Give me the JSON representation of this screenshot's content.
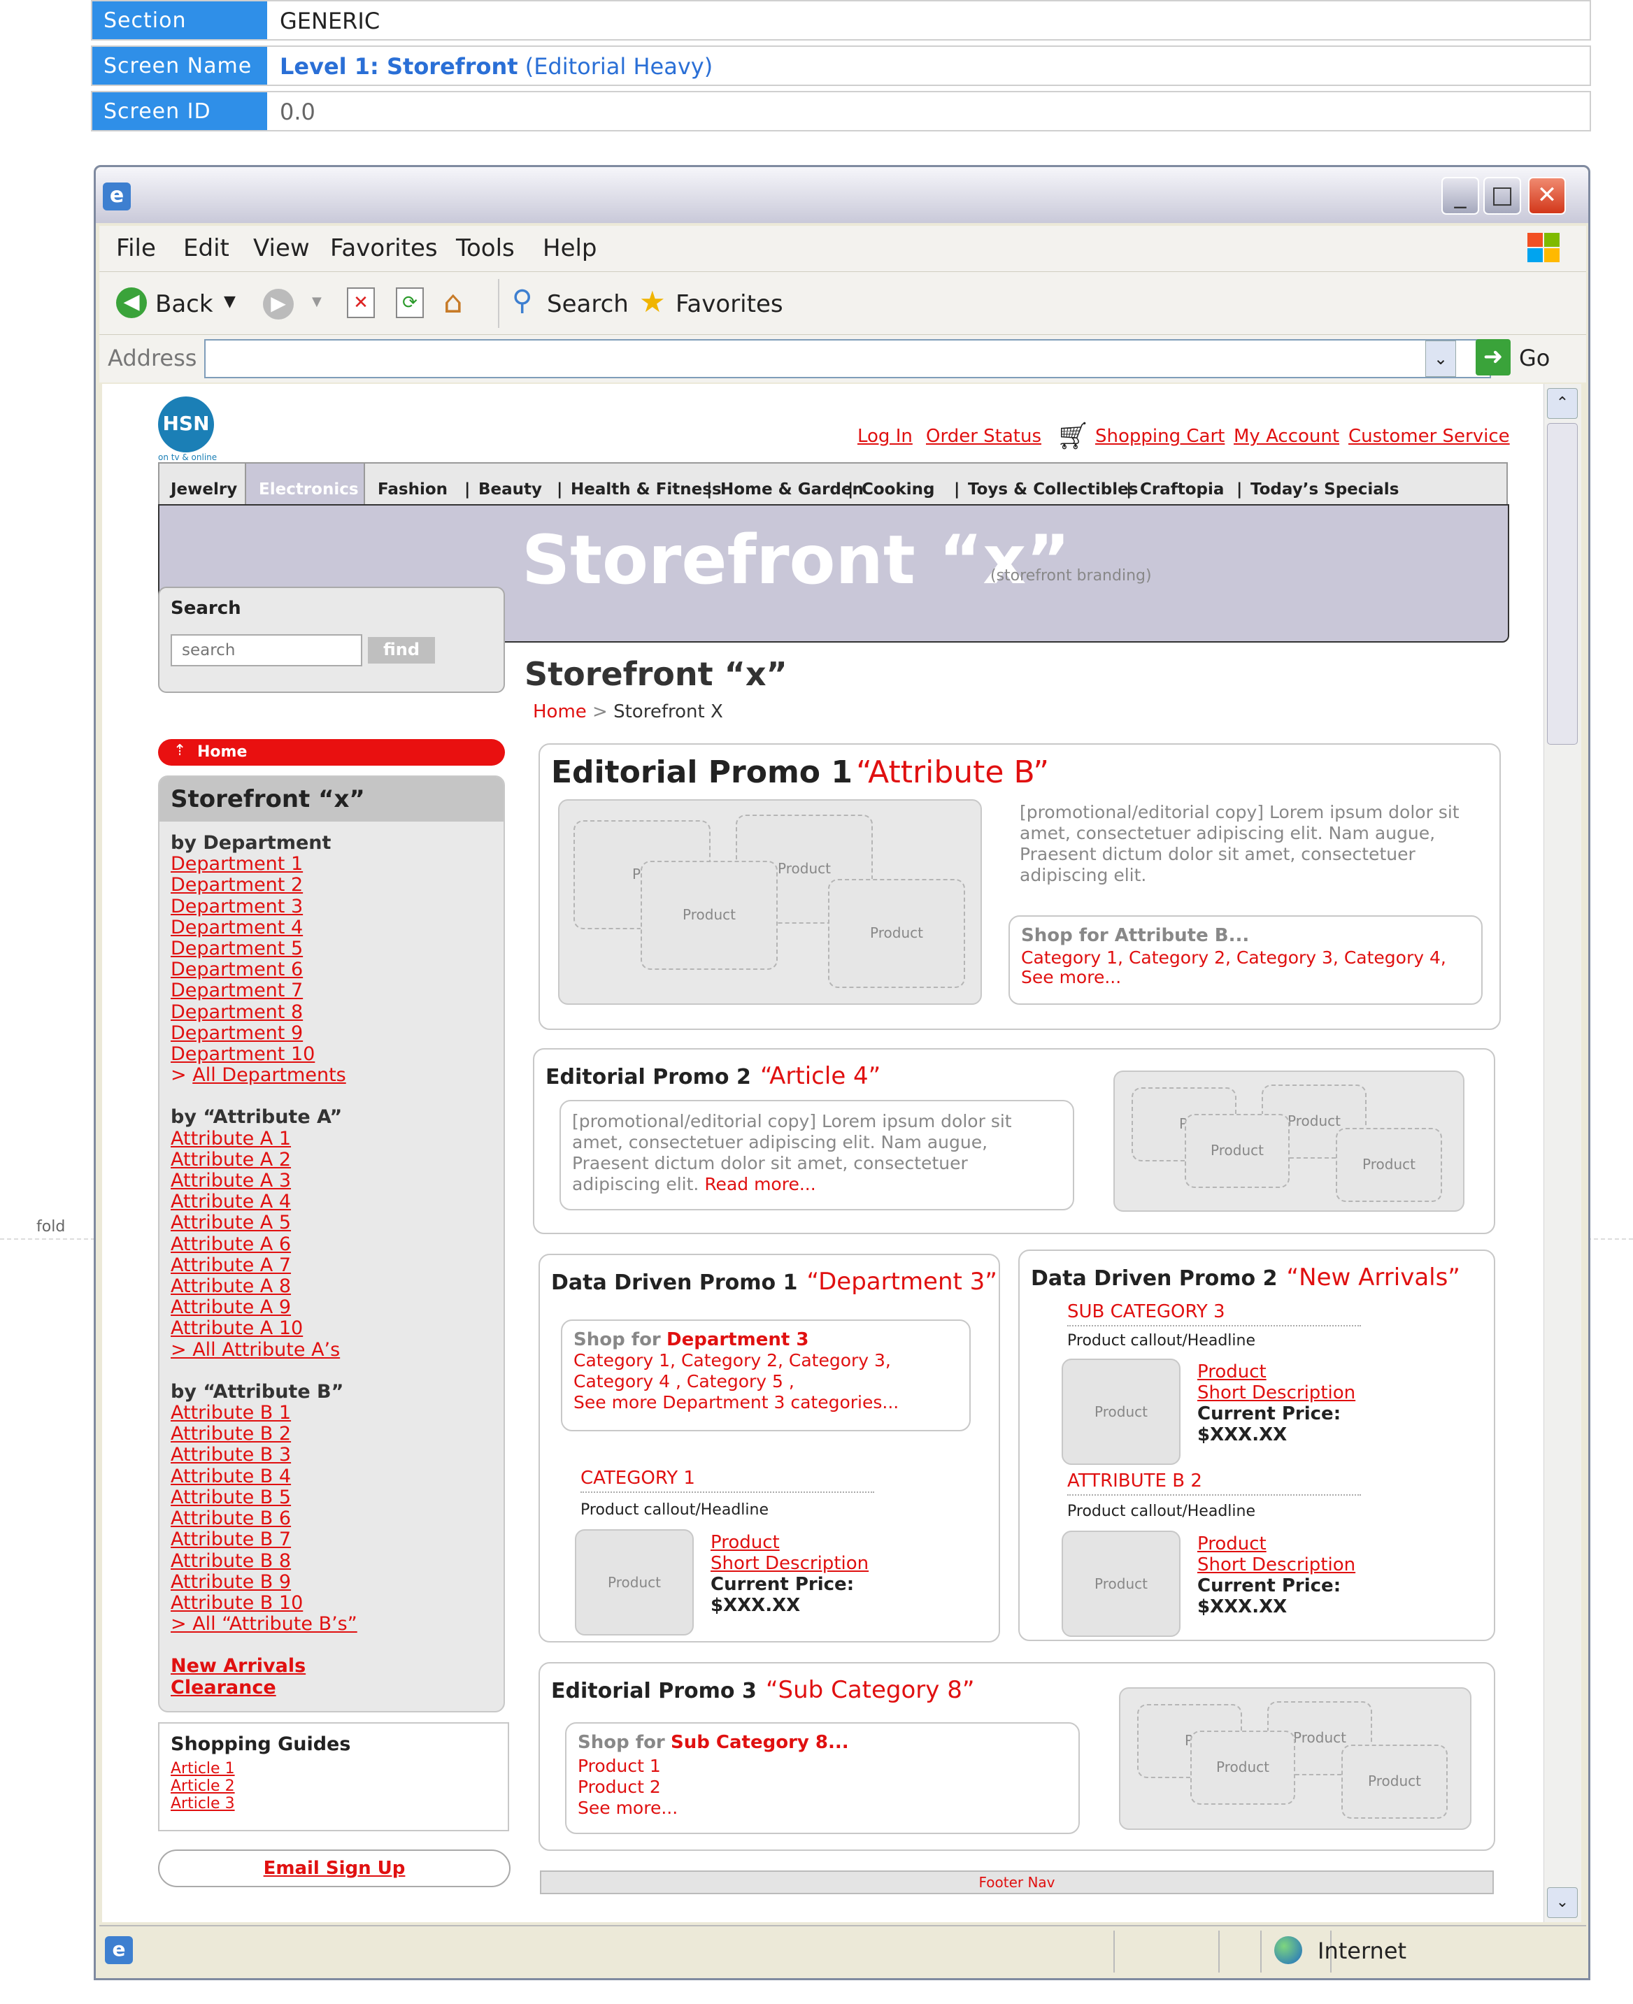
{
  "spec": {
    "section_key": "Section",
    "section_val": "GENERIC",
    "screen_name_key": "Screen Name",
    "screen_name_bold": "Level 1: Storefront",
    "screen_name_rest": "(Editorial Heavy)",
    "screen_id_key": "Screen ID",
    "screen_id_val": "0.0"
  },
  "fold_label": "fold",
  "menu": [
    "File",
    "Edit",
    "View",
    "Favorites",
    "Tools",
    "Help"
  ],
  "toolbar": {
    "back": "Back",
    "search": "Search",
    "favorites": "Favorites"
  },
  "address": {
    "label": "Address",
    "go": "Go",
    "value": ""
  },
  "status": {
    "zone": "Internet"
  },
  "logo": {
    "text": "HSN",
    "tagline": "on tv & online"
  },
  "utility_links": [
    "Log In",
    "Order Status",
    "Shopping Cart",
    "My Account",
    "Customer Service"
  ],
  "nav_tabs": [
    "Jewelry",
    "Electronics",
    "Fashion",
    "Beauty",
    "Health & Fitness",
    "Home & Garden",
    "Cooking",
    "Toys & Collectibles",
    "Craftopia",
    "Today’s Specials"
  ],
  "nav_sep": "|",
  "banner": {
    "title": "Storefront “x”",
    "note": "(storefront branding)"
  },
  "search": {
    "title": "Search",
    "placeholder": "search",
    "button": "find"
  },
  "page_title": "Storefront “x”",
  "breadcrumb": {
    "home": "Home",
    "sep": ">",
    "current": "Storefront X"
  },
  "left": {
    "home": "Home",
    "title": "Storefront “x”",
    "by_department": "by Department",
    "departments": [
      "Department 1",
      "Department 2",
      "Department 3",
      "Department 4",
      "Department 5",
      "Department 6",
      "Department 7",
      "Department 8",
      "Department 9",
      "Department 10"
    ],
    "all_departments_arrow": ">",
    "all_departments": "All Departments",
    "by_attr_a": "by “Attribute A”",
    "attr_a": [
      "Attribute A 1",
      "Attribute A 2",
      "Attribute A 3",
      "Attribute A 4",
      "Attribute A 5",
      "Attribute A 6",
      "Attribute A 7",
      "Attribute A 8",
      "Attribute A 9",
      "Attribute A 10"
    ],
    "all_attr_a": "> All Attribute A’s",
    "by_attr_b": "by “Attribute B”",
    "attr_b": [
      "Attribute B 1",
      "Attribute B 2",
      "Attribute B 3",
      "Attribute B 4",
      "Attribute B 5",
      "Attribute B 6",
      "Attribute B 7",
      "Attribute B 8",
      "Attribute B 9",
      "Attribute B 10"
    ],
    "all_attr_b": "> All “Attribute B’s”",
    "new_arrivals": "New Arrivals",
    "clearance": "Clearance",
    "guides_title": "Shopping Guides",
    "guides": [
      "Article 1",
      "Article 2",
      "Article 3"
    ],
    "email": "Email Sign Up"
  },
  "promo1": {
    "title": "Editorial Promo 1",
    "attr": "“Attribute B”",
    "copy": "[promotional/editorial copy] Lorem ipsum dolor sit amet, consectetuer adipiscing elit. Nam augue, Praesent dictum dolor sit amet, consectetuer adipiscing elit.",
    "shop": "Shop for Attribute B...",
    "cats": "Category 1, Category 2, Category 3, Category 4,",
    "more": "See more..."
  },
  "promo2": {
    "title": "Editorial Promo 2",
    "attr": "“Article 4”",
    "copy": "[promotional/editorial copy] Lorem ipsum dolor sit amet, consectetuer adipiscing elit. Nam augue, Praesent dictum dolor sit amet, consectetuer adipiscing elit.",
    "read_more": "Read more..."
  },
  "dd1": {
    "title": "Data Driven Promo 1",
    "attr": "“Department 3”",
    "shop_pre": "Shop for",
    "shop_dept": "Department 3",
    "cats1": "Category 1, Category 2, Category 3,",
    "cats2": "Category 4 , Category 5 ,",
    "see_more": "See more Department 3 categories...",
    "cat_label": "CATEGORY 1",
    "callout": "Product callout/Headline",
    "product": "Product",
    "short_desc": "Short Description",
    "price_label": "Current Price:",
    "price": "$XXX.XX"
  },
  "dd2": {
    "title": "Data Driven Promo 2",
    "attr": "“New Arrivals”",
    "sub_label": "SUB CATEGORY 3",
    "attr_label": "ATTRIBUTE B 2",
    "callout": "Product callout/Headline",
    "product": "Product",
    "short_desc": "Short Description",
    "price_label": "Current Price:",
    "price": "$XXX.XX"
  },
  "promo3": {
    "title": "Editorial Promo 3",
    "attr": "“Sub Category 8”",
    "shop_pre": "Shop for",
    "shop_sub": "Sub Category 8...",
    "p1": "Product 1",
    "p2": "Product 2",
    "more": "See more..."
  },
  "product_tile": "Product",
  "product_tile_cut": "Proc",
  "footer_nav": "Footer Nav"
}
